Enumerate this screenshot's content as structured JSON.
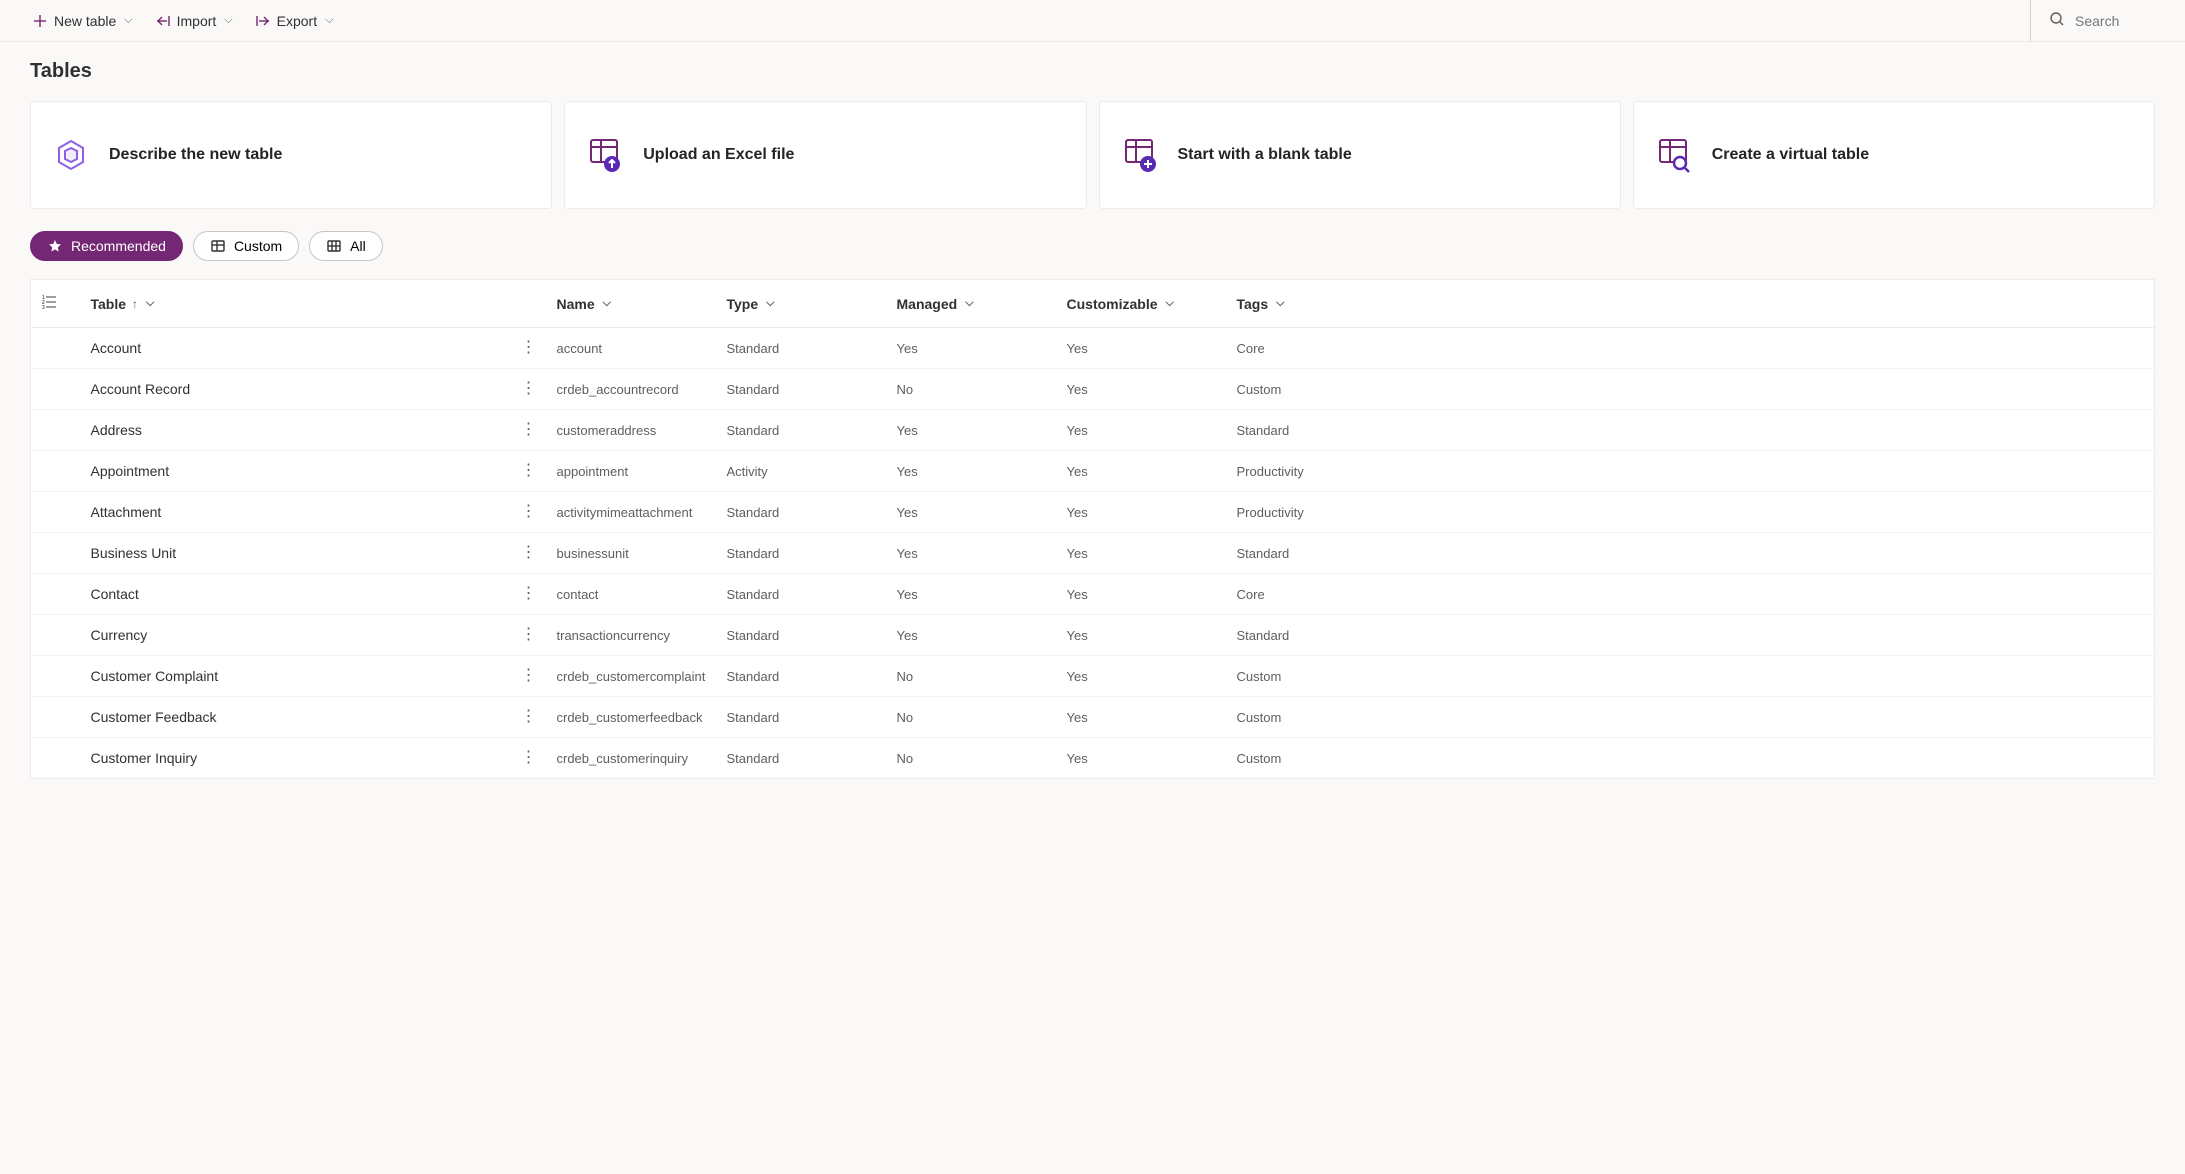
{
  "toolbar": {
    "new_table": "New table",
    "import": "Import",
    "export": "Export",
    "search_placeholder": "Search"
  },
  "page": {
    "title": "Tables"
  },
  "cards": [
    {
      "title": "Describe the new table"
    },
    {
      "title": "Upload an Excel file"
    },
    {
      "title": "Start with a blank table"
    },
    {
      "title": "Create a virtual table"
    }
  ],
  "filters": {
    "recommended": "Recommended",
    "custom": "Custom",
    "all": "All"
  },
  "columns": {
    "table": "Table",
    "name": "Name",
    "type": "Type",
    "managed": "Managed",
    "customizable": "Customizable",
    "tags": "Tags"
  },
  "rows": [
    {
      "table": "Account",
      "name": "account",
      "type": "Standard",
      "managed": "Yes",
      "customizable": "Yes",
      "tags": "Core"
    },
    {
      "table": "Account Record",
      "name": "crdeb_accountrecord",
      "type": "Standard",
      "managed": "No",
      "customizable": "Yes",
      "tags": "Custom"
    },
    {
      "table": "Address",
      "name": "customeraddress",
      "type": "Standard",
      "managed": "Yes",
      "customizable": "Yes",
      "tags": "Standard"
    },
    {
      "table": "Appointment",
      "name": "appointment",
      "type": "Activity",
      "managed": "Yes",
      "customizable": "Yes",
      "tags": "Productivity"
    },
    {
      "table": "Attachment",
      "name": "activitymimeattachment",
      "type": "Standard",
      "managed": "Yes",
      "customizable": "Yes",
      "tags": "Productivity"
    },
    {
      "table": "Business Unit",
      "name": "businessunit",
      "type": "Standard",
      "managed": "Yes",
      "customizable": "Yes",
      "tags": "Standard"
    },
    {
      "table": "Contact",
      "name": "contact",
      "type": "Standard",
      "managed": "Yes",
      "customizable": "Yes",
      "tags": "Core"
    },
    {
      "table": "Currency",
      "name": "transactioncurrency",
      "type": "Standard",
      "managed": "Yes",
      "customizable": "Yes",
      "tags": "Standard"
    },
    {
      "table": "Customer Complaint",
      "name": "crdeb_customercomplaint",
      "type": "Standard",
      "managed": "No",
      "customizable": "Yes",
      "tags": "Custom"
    },
    {
      "table": "Customer Feedback",
      "name": "crdeb_customerfeedback",
      "type": "Standard",
      "managed": "No",
      "customizable": "Yes",
      "tags": "Custom"
    },
    {
      "table": "Customer Inquiry",
      "name": "crdeb_customerinquiry",
      "type": "Standard",
      "managed": "No",
      "customizable": "Yes",
      "tags": "Custom"
    }
  ],
  "colors": {
    "accent": "#742774"
  }
}
